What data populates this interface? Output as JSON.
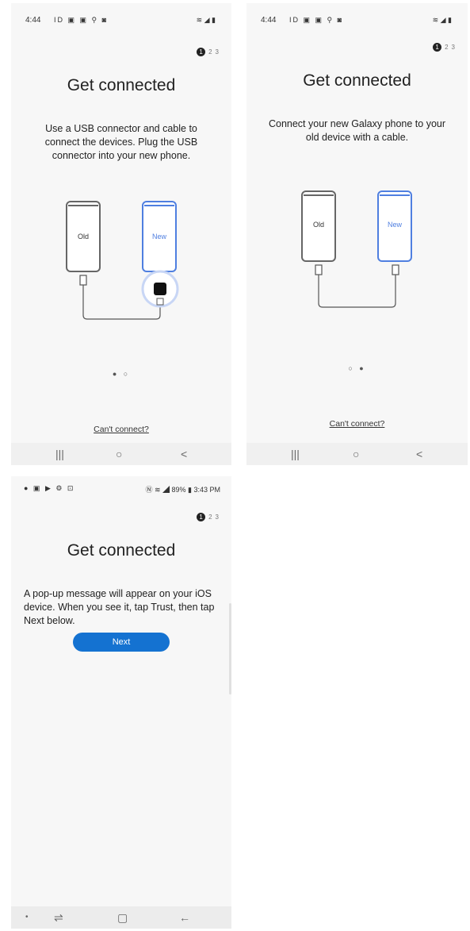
{
  "screens": [
    {
      "status_time": "4:44",
      "title": "Get connected",
      "step": {
        "current": "1",
        "others": [
          "2",
          "3"
        ]
      },
      "description": "Use a USB connector and cable to connect the devices. Plug the USB connector into your new phone.",
      "old_label": "Old",
      "new_label": "New",
      "pager": "● ○",
      "cant_connect": "Can't connect?"
    },
    {
      "status_time": "4:44",
      "title": "Get connected",
      "step": {
        "current": "1",
        "others": [
          "2",
          "3"
        ]
      },
      "description": "Connect your new Galaxy phone to your old device with a cable.",
      "old_label": "Old",
      "new_label": "New",
      "pager": "○ ●",
      "cant_connect": "Can't connect?"
    },
    {
      "status_right": "89% ▮ 3:43 PM",
      "title": "Get connected",
      "step": {
        "current": "1",
        "others": [
          "2",
          "3"
        ]
      },
      "description": "A pop-up message will appear on your iOS device. When you see it, tap Trust, then tap Next below.",
      "next_label": "Next"
    }
  ],
  "navbar": {
    "recents": "|||",
    "home": "○",
    "back": "<"
  },
  "colors": {
    "accent": "#1472d1",
    "new_phone": "#4f7fe0",
    "old_phone": "#666666"
  }
}
